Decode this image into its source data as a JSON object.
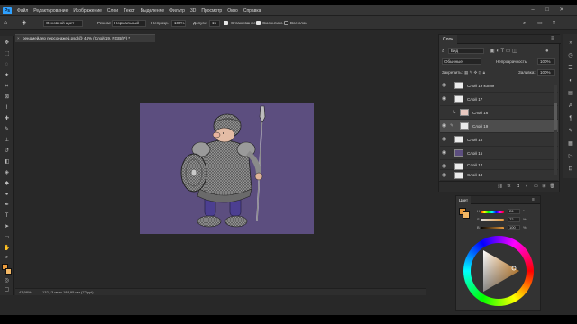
{
  "menu": {
    "logo": "Ps",
    "items": [
      "Файл",
      "Редактирование",
      "Изображение",
      "Слои",
      "Текст",
      "Выделение",
      "Фильтр",
      "3D",
      "Просмотр",
      "Окно",
      "Справка"
    ]
  },
  "options": {
    "fill_source": "Основной цвет",
    "mode_label": "Режим:",
    "mode_value": "Нормальный",
    "opacity_label": "Непрозр.:",
    "opacity_value": "100%",
    "tolerance_label": "Допуск:",
    "tolerance_value": "15",
    "smoothing_label": "Сглаживание",
    "contiguous_label": "Смеж.пикс.",
    "all_layers_label": "Все слои"
  },
  "document": {
    "tab_title": "рендмейдер персонажей.psd @ 44% (Слой 19, RGB/8*) *",
    "zoom": "43,98%",
    "dims": "132,13 мм x 188,95 мм (72 ppi)"
  },
  "layers_panel": {
    "tab": "Слои",
    "filter_value": "Вид",
    "blend_mode": "Обычные",
    "opacity_label": "Непрозрачность:",
    "opacity_value": "100%",
    "lock_label": "Закрепить:",
    "fill_label": "Заливка:",
    "fill_value": "100%",
    "layers": [
      {
        "name": "Слой 19 копия",
        "visible": true,
        "selected": false
      },
      {
        "name": "Слой 17",
        "visible": true,
        "selected": false
      },
      {
        "name": "Слой 16",
        "visible": false,
        "selected": false
      },
      {
        "name": "Слой 19",
        "visible": true,
        "selected": true
      },
      {
        "name": "Слой 18",
        "visible": true,
        "selected": false
      },
      {
        "name": "Слой 15",
        "visible": true,
        "selected": false
      },
      {
        "name": "Слой 14",
        "visible": true,
        "selected": false
      },
      {
        "name": "Слой 13",
        "visible": true,
        "selected": false
      }
    ]
  },
  "color_panel": {
    "tab": "Цвет",
    "rows": [
      {
        "label": "H",
        "value": "26",
        "unit": "°"
      },
      {
        "label": "S",
        "value": "72",
        "unit": "%"
      },
      {
        "label": "B",
        "value": "100",
        "unit": "%"
      }
    ],
    "foreground": "#e89a3c",
    "background": "#f2b765"
  },
  "colors": {
    "canvas_bg": "#5c4e7f",
    "accent": "#2fa1ff"
  }
}
